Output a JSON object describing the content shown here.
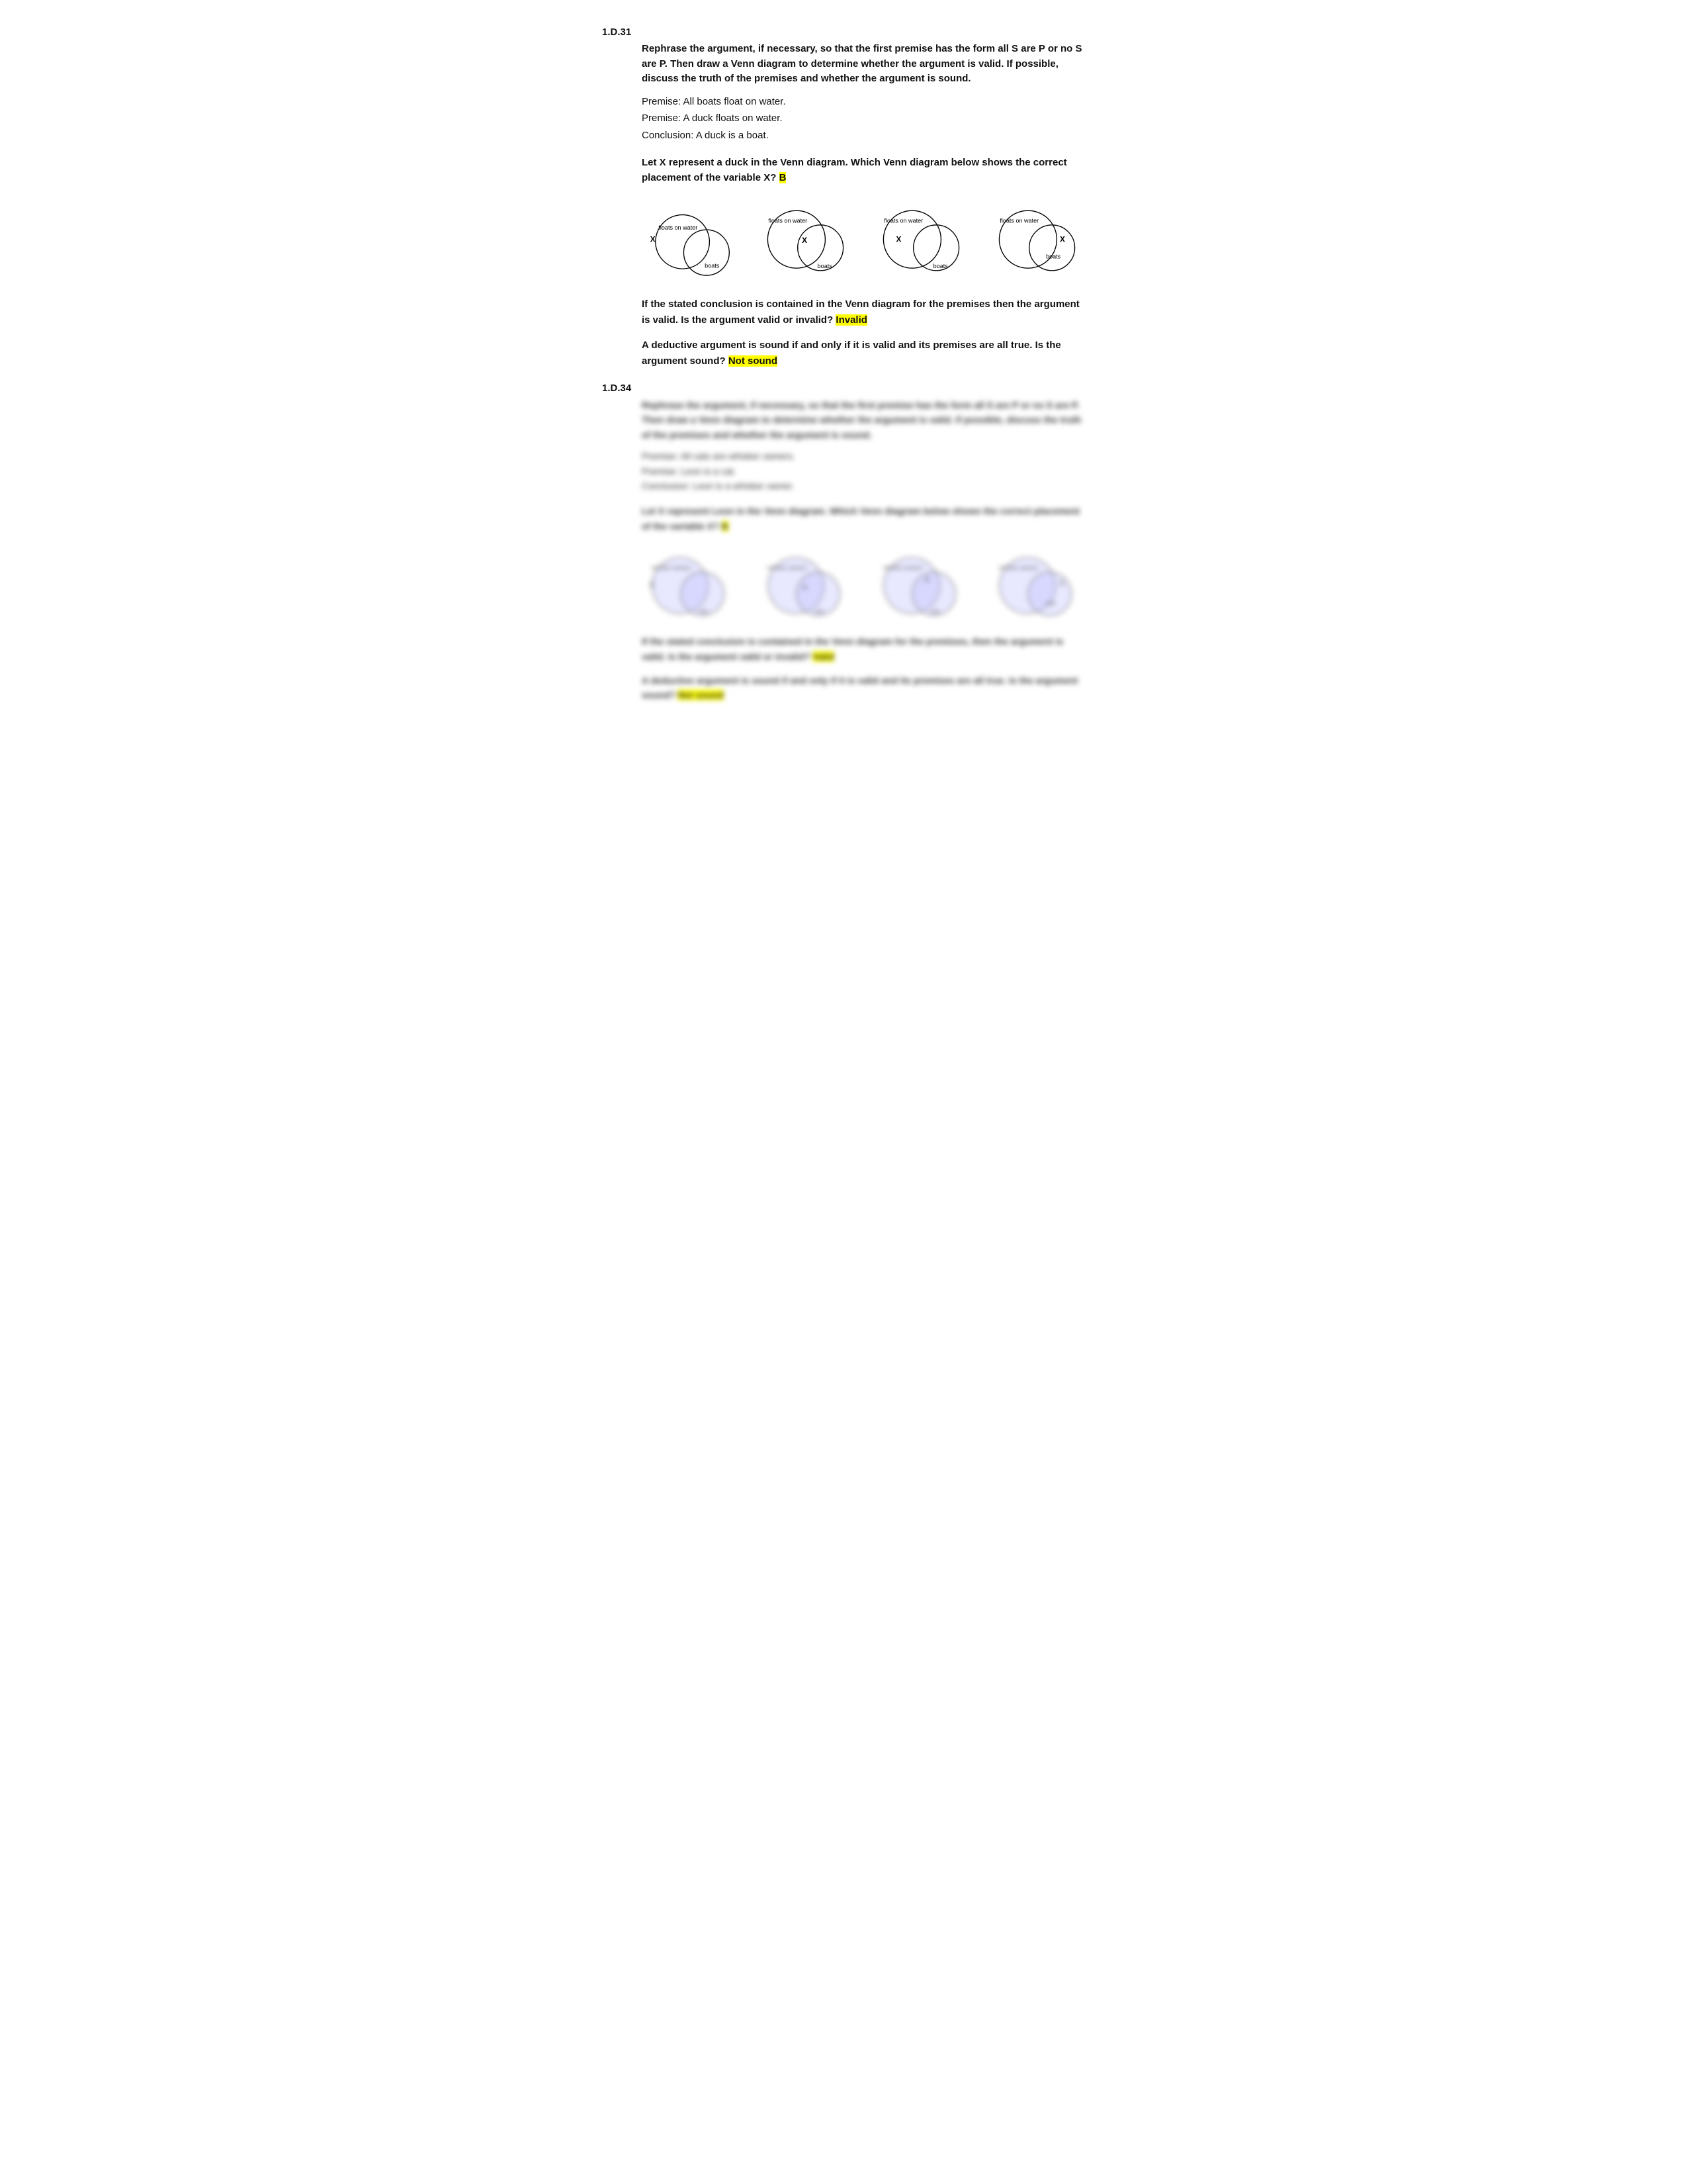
{
  "problem1": {
    "label": "1.D.31",
    "instruction": "Rephrase the argument, if necessary, so that the first premise has the form all S are P or no S are P. Then draw a Venn diagram to determine whether the argument is valid. If possible, discuss the truth of the premises and whether the argument is sound.",
    "premise1": "Premise:  All boats float on water.",
    "premise2": "Premise:  A duck floats on water.",
    "conclusion": "Conclusion:  A duck is a boat.",
    "question_venn": "Let X represent a duck in the Venn diagram. Which Venn diagram below shows the correct placement of the variable X?",
    "answer_venn": "B",
    "question_valid": "If the stated conclusion is contained in the Venn diagram for the premises then the argument is valid. Is the argument valid or invalid?",
    "answer_valid": "Invalid",
    "question_sound": "A deductive argument is sound if and only if it is valid and its premises are all true. Is the argument sound?",
    "answer_sound": "Not sound",
    "diagrams": [
      {
        "id": "A",
        "circle1_label": "floats on water",
        "circle2_label": "boats",
        "x_position": "outside_left",
        "x_label": "X"
      },
      {
        "id": "B",
        "circle1_label": "floats on water",
        "circle2_label": "boats",
        "x_position": "overlap",
        "x_label": "X"
      },
      {
        "id": "C",
        "circle1_label": "floats on water",
        "circle2_label": "boats",
        "x_position": "inside_left",
        "x_label": "X"
      },
      {
        "id": "D",
        "circle1_label": "floats on water",
        "circle2_label": "boats",
        "x_position": "inside_right",
        "x_label": "X"
      }
    ]
  },
  "problem2": {
    "label": "1.D.34",
    "blurred": true
  }
}
